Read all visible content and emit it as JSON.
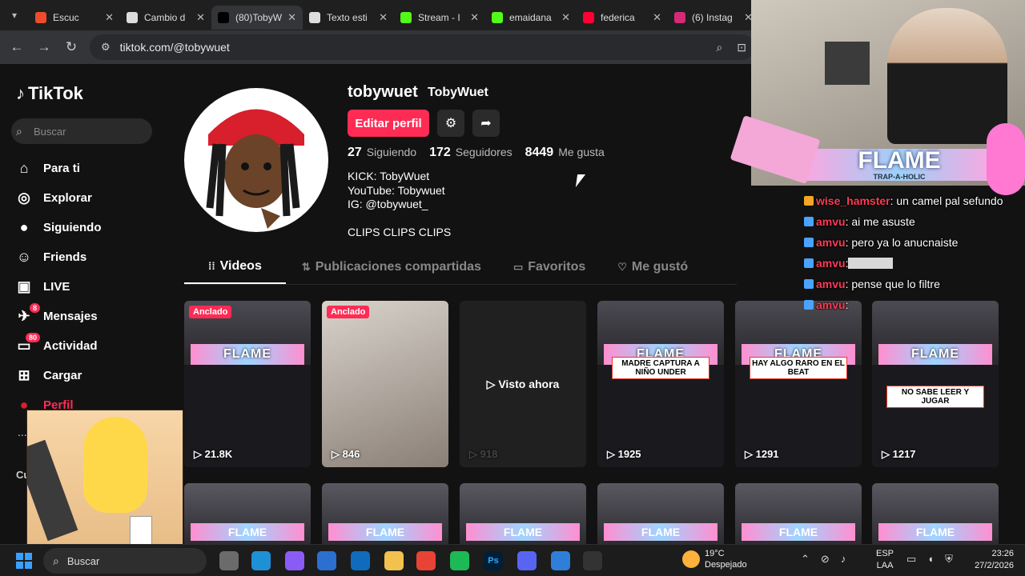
{
  "browser": {
    "tabs": [
      {
        "title": "Escuc",
        "color": "#ee4d2d"
      },
      {
        "title": "Cambio d",
        "color": "#dddddd"
      },
      {
        "title": "(80)TobyW",
        "color": "#000000"
      },
      {
        "title": "Texto esti",
        "color": "#dddddd"
      },
      {
        "title": "Stream - I",
        "color": "#53fc18"
      },
      {
        "title": "emaidana",
        "color": "#53fc18"
      },
      {
        "title": "federica",
        "color": "#ff0033"
      },
      {
        "title": "(6) Instag",
        "color": "#d62976"
      }
    ],
    "url": "tiktok.com/@tobywuet"
  },
  "tiktok": {
    "logo": "TikTok",
    "search_placeholder": "Buscar",
    "nav": [
      {
        "label": "Para ti",
        "icon": "home-icon",
        "glyph": "⌂"
      },
      {
        "label": "Explorar",
        "icon": "compass-icon",
        "glyph": "◎"
      },
      {
        "label": "Siguiendo",
        "icon": "following-icon",
        "glyph": "●"
      },
      {
        "label": "Friends",
        "icon": "friends-icon",
        "glyph": "☺"
      },
      {
        "label": "LIVE",
        "icon": "live-icon",
        "glyph": "▣"
      },
      {
        "label": "Mensajes",
        "icon": "messages-icon",
        "glyph": "✈",
        "badge": "8"
      },
      {
        "label": "Actividad",
        "icon": "activity-icon",
        "glyph": "▭",
        "badge": "80"
      },
      {
        "label": "Cargar",
        "icon": "upload-icon",
        "glyph": "⊞"
      },
      {
        "label": "Perfil",
        "icon": "profile-icon",
        "glyph": "●"
      }
    ],
    "more": "...",
    "cut_label": "Cu",
    "profile": {
      "username": "tobywuet",
      "nickname": "TobyWuet",
      "edit_label": "Editar perfil",
      "following_count": "27",
      "following_label": "Siguiendo",
      "followers_count": "172",
      "followers_label": "Seguidores",
      "likes_count": "8449",
      "likes_label": "Me gusta",
      "bio_lines": [
        "KICK: TobyWuet",
        "YouTube: Tobywuet",
        "IG: @tobywuet_"
      ],
      "bio_footer": "CLIPS CLIPS CLIPS"
    },
    "tabs": [
      {
        "label": "Videos",
        "icon": "grid-icon",
        "glyph": "⁞⁞"
      },
      {
        "label": "Publicaciones compartidas",
        "icon": "repost-icon",
        "glyph": "⇅"
      },
      {
        "label": "Favoritos",
        "icon": "bookmark-icon",
        "glyph": "▭"
      },
      {
        "label": "Me gustó",
        "icon": "heart-icon",
        "glyph": "♡"
      }
    ],
    "videos": [
      {
        "views": "21.8K",
        "pinned": "Anclado",
        "caption": ""
      },
      {
        "views": "846",
        "pinned": "Anclado",
        "caption": ""
      },
      {
        "views": "918",
        "watched": "Visto ahora",
        "caption": ""
      },
      {
        "views": "1925",
        "caption": "MADRE CAPTURA A NIÑO UNDER"
      },
      {
        "views": "1291",
        "caption": "HAY ALGO RARO EN EL BEAT"
      },
      {
        "views": "1217",
        "caption": "NO SABE LEER Y JUGAR"
      }
    ],
    "flame_text": "FLAME"
  },
  "overlay": {
    "flame_title": "FLAME",
    "flame_sub": "TRAP-A-HOLIC",
    "chat": [
      {
        "user": "wise_hamster",
        "text": ": un camel pal sefundo"
      },
      {
        "user": "amvu",
        "text": ": ai me asuste"
      },
      {
        "user": "amvu",
        "text": ": pero ya lo anucnaiste"
      },
      {
        "user": "amvu",
        "text": ":"
      },
      {
        "user": "amvu",
        "text": ": pense que lo filtre"
      },
      {
        "user": "amvu",
        "text": ":"
      }
    ]
  },
  "taskbar": {
    "search_label": "Buscar",
    "weather_temp": "19°C",
    "weather_desc": "Despejado",
    "lang_line1": "ESP",
    "lang_line2": "LAA",
    "time": "23:26",
    "date": "27/2/2026",
    "apps": [
      {
        "icon": "file-explorer-icon",
        "color": "#6b6b6b"
      },
      {
        "icon": "edge-icon",
        "color": "#1e90d6"
      },
      {
        "icon": "copilot-icon",
        "color": "#8a5cf6"
      },
      {
        "icon": "store-icon",
        "color": "#2b6fd1"
      },
      {
        "icon": "outlook-icon",
        "color": "#0f6cbd"
      },
      {
        "icon": "folder-icon",
        "color": "#f2c14e"
      },
      {
        "icon": "chrome-icon",
        "color": "#e84335"
      },
      {
        "icon": "spotify-icon",
        "color": "#1db954"
      },
      {
        "icon": "photoshop-icon",
        "color": "#001e36",
        "text": "Ps"
      },
      {
        "icon": "discord-icon",
        "color": "#5865f2"
      },
      {
        "icon": "snipping-icon",
        "color": "#2f7fd8"
      },
      {
        "icon": "obs-icon",
        "color": "#333333"
      }
    ]
  }
}
